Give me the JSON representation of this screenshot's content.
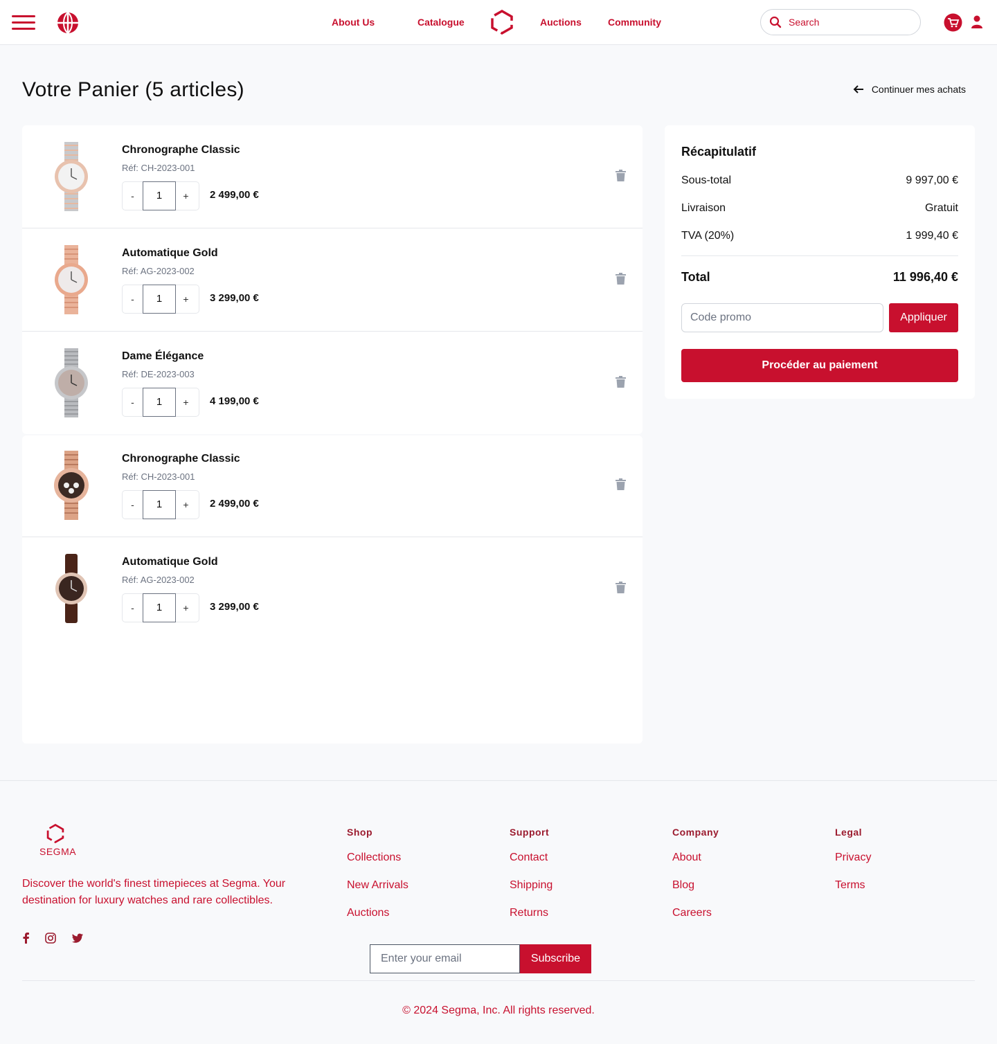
{
  "brand": {
    "name": "SEGMA",
    "accent_color": "#c8102e"
  },
  "nav": {
    "links": [
      "About Us",
      "Catalogue",
      "Auctions",
      "Community"
    ],
    "search_placeholder": "Search"
  },
  "cart": {
    "title": "Votre Panier (5 articles)",
    "continue_label": "Continuer mes achats",
    "items": [
      {
        "name": "Chronographe Classic",
        "ref": "Réf: CH-2023-001",
        "qty": "1",
        "price": "2 499,00 €",
        "watch_style": "two-tone-steel"
      },
      {
        "name": "Automatique Gold",
        "ref": "Réf: AG-2023-002",
        "qty": "1",
        "price": "3 299,00 €",
        "watch_style": "rose-gold"
      },
      {
        "name": "Dame Élégance",
        "ref": "Réf: DE-2023-003",
        "qty": "1",
        "price": "4 199,00 €",
        "watch_style": "steel"
      },
      {
        "name": "Chronographe Classic",
        "ref": "Réf: CH-2023-001",
        "qty": "1",
        "price": "2 499,00 €",
        "watch_style": "rose-gold-chrono"
      },
      {
        "name": "Automatique Gold",
        "ref": "Réf: AG-2023-002",
        "qty": "1",
        "price": "3 299,00 €",
        "watch_style": "brown-leather"
      }
    ],
    "minus_label": "-",
    "plus_label": "+"
  },
  "summary": {
    "title": "Récapitulatif",
    "rows": [
      {
        "label": "Sous-total",
        "value": "9 997,00 €"
      },
      {
        "label": "Livraison",
        "value": "Gratuit"
      },
      {
        "label": "TVA (20%)",
        "value": "1 999,40 €"
      }
    ],
    "total_label": "Total",
    "total_value": "11 996,40 €",
    "promo_placeholder": "Code promo",
    "apply_label": "Appliquer",
    "checkout_label": "Procéder au paiement"
  },
  "footer": {
    "logo_text": "SEGMA",
    "description": "Discover the world's finest timepieces at Segma. Your destination for luxury watches and rare collectibles.",
    "columns": [
      {
        "title": "Shop",
        "links": [
          "Collections",
          "New Arrivals",
          "Auctions"
        ]
      },
      {
        "title": "Support",
        "links": [
          "Contact",
          "Shipping",
          "Returns"
        ]
      },
      {
        "title": "Company",
        "links": [
          "About",
          "Blog",
          "Careers"
        ]
      },
      {
        "title": "Legal",
        "links": [
          "Privacy",
          "Terms"
        ]
      }
    ],
    "email_placeholder": "Enter your email",
    "subscribe_label": "Subscribe",
    "copyright": "© 2024 Segma, Inc. All rights reserved.",
    "social_icons": [
      "facebook-icon",
      "instagram-icon",
      "twitter-icon"
    ]
  }
}
